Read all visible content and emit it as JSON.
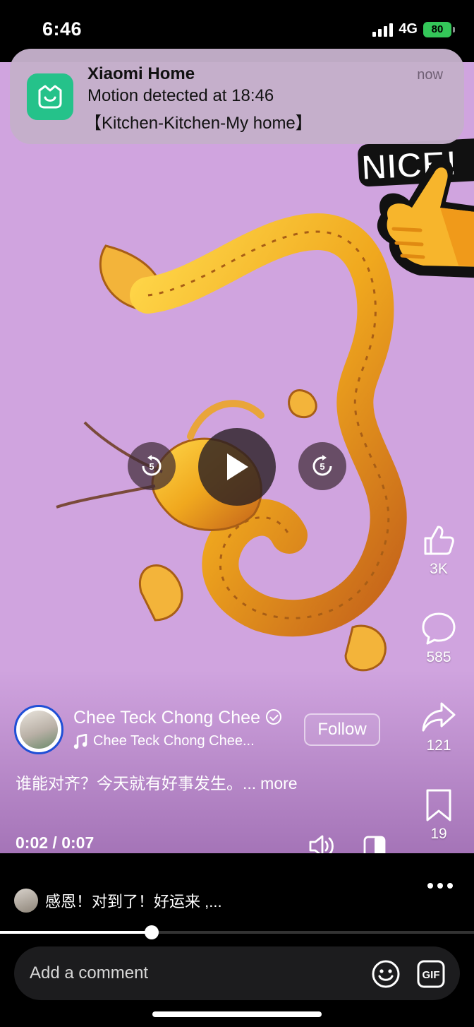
{
  "status_bar": {
    "time": "6:46",
    "network": "4G",
    "battery": "80"
  },
  "notification": {
    "app_name": "Xiaomi Home",
    "time": "now",
    "message_line1": "Motion detected at 18:46",
    "message_line2": "【Kitchen-Kitchen-My home】",
    "icon": "xiaomi-home-icon",
    "icon_color": "#25c28a"
  },
  "video": {
    "background_color": "#d0a4df",
    "sticker_text": "NICE!",
    "controls": {
      "rewind_seconds": "5",
      "forward_seconds": "5"
    },
    "current_time": "0:02",
    "time_separator": " / ",
    "duration": "0:07",
    "progress_fraction": 0.32
  },
  "actions": {
    "likes": "3K",
    "comments": "585",
    "shares": "121",
    "saves": "19"
  },
  "author": {
    "name": "Chee Teck Chong Chee",
    "audio": "Chee Teck Chong Chee...",
    "follow_label": "Follow",
    "verified": true
  },
  "caption": {
    "text": "谁能对齐？今天就有好事发生。...",
    "more_label": "more"
  },
  "top_comment": {
    "text": "感恩！对到了！好运来 ,..."
  },
  "comment_input": {
    "placeholder": "Add a comment",
    "gif_label": "GIF"
  }
}
